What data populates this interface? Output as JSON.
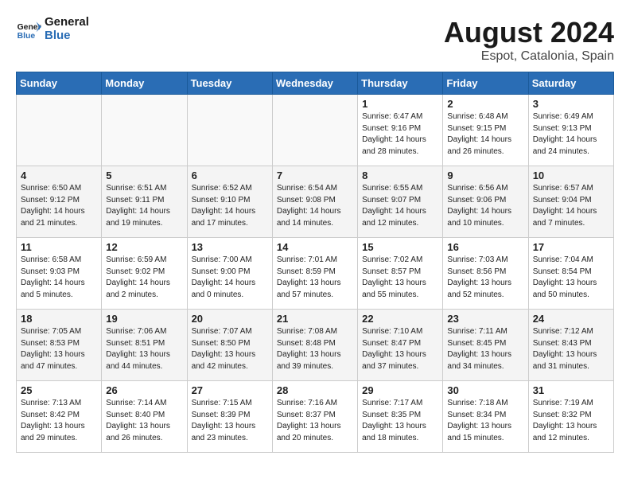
{
  "header": {
    "logo_general": "General",
    "logo_blue": "Blue",
    "month_year": "August 2024",
    "location": "Espot, Catalonia, Spain"
  },
  "days_of_week": [
    "Sunday",
    "Monday",
    "Tuesday",
    "Wednesday",
    "Thursday",
    "Friday",
    "Saturday"
  ],
  "weeks": [
    [
      {
        "day": "",
        "empty": true
      },
      {
        "day": "",
        "empty": true
      },
      {
        "day": "",
        "empty": true
      },
      {
        "day": "",
        "empty": true
      },
      {
        "day": "1",
        "sunrise": "6:47 AM",
        "sunset": "9:16 PM",
        "daylight": "14 hours and 28 minutes."
      },
      {
        "day": "2",
        "sunrise": "6:48 AM",
        "sunset": "9:15 PM",
        "daylight": "14 hours and 26 minutes."
      },
      {
        "day": "3",
        "sunrise": "6:49 AM",
        "sunset": "9:13 PM",
        "daylight": "14 hours and 24 minutes."
      }
    ],
    [
      {
        "day": "4",
        "sunrise": "6:50 AM",
        "sunset": "9:12 PM",
        "daylight": "14 hours and 21 minutes."
      },
      {
        "day": "5",
        "sunrise": "6:51 AM",
        "sunset": "9:11 PM",
        "daylight": "14 hours and 19 minutes."
      },
      {
        "day": "6",
        "sunrise": "6:52 AM",
        "sunset": "9:10 PM",
        "daylight": "14 hours and 17 minutes."
      },
      {
        "day": "7",
        "sunrise": "6:54 AM",
        "sunset": "9:08 PM",
        "daylight": "14 hours and 14 minutes."
      },
      {
        "day": "8",
        "sunrise": "6:55 AM",
        "sunset": "9:07 PM",
        "daylight": "14 hours and 12 minutes."
      },
      {
        "day": "9",
        "sunrise": "6:56 AM",
        "sunset": "9:06 PM",
        "daylight": "14 hours and 10 minutes."
      },
      {
        "day": "10",
        "sunrise": "6:57 AM",
        "sunset": "9:04 PM",
        "daylight": "14 hours and 7 minutes."
      }
    ],
    [
      {
        "day": "11",
        "sunrise": "6:58 AM",
        "sunset": "9:03 PM",
        "daylight": "14 hours and 5 minutes."
      },
      {
        "day": "12",
        "sunrise": "6:59 AM",
        "sunset": "9:02 PM",
        "daylight": "14 hours and 2 minutes."
      },
      {
        "day": "13",
        "sunrise": "7:00 AM",
        "sunset": "9:00 PM",
        "daylight": "14 hours and 0 minutes."
      },
      {
        "day": "14",
        "sunrise": "7:01 AM",
        "sunset": "8:59 PM",
        "daylight": "13 hours and 57 minutes."
      },
      {
        "day": "15",
        "sunrise": "7:02 AM",
        "sunset": "8:57 PM",
        "daylight": "13 hours and 55 minutes."
      },
      {
        "day": "16",
        "sunrise": "7:03 AM",
        "sunset": "8:56 PM",
        "daylight": "13 hours and 52 minutes."
      },
      {
        "day": "17",
        "sunrise": "7:04 AM",
        "sunset": "8:54 PM",
        "daylight": "13 hours and 50 minutes."
      }
    ],
    [
      {
        "day": "18",
        "sunrise": "7:05 AM",
        "sunset": "8:53 PM",
        "daylight": "13 hours and 47 minutes."
      },
      {
        "day": "19",
        "sunrise": "7:06 AM",
        "sunset": "8:51 PM",
        "daylight": "13 hours and 44 minutes."
      },
      {
        "day": "20",
        "sunrise": "7:07 AM",
        "sunset": "8:50 PM",
        "daylight": "13 hours and 42 minutes."
      },
      {
        "day": "21",
        "sunrise": "7:08 AM",
        "sunset": "8:48 PM",
        "daylight": "13 hours and 39 minutes."
      },
      {
        "day": "22",
        "sunrise": "7:10 AM",
        "sunset": "8:47 PM",
        "daylight": "13 hours and 37 minutes."
      },
      {
        "day": "23",
        "sunrise": "7:11 AM",
        "sunset": "8:45 PM",
        "daylight": "13 hours and 34 minutes."
      },
      {
        "day": "24",
        "sunrise": "7:12 AM",
        "sunset": "8:43 PM",
        "daylight": "13 hours and 31 minutes."
      }
    ],
    [
      {
        "day": "25",
        "sunrise": "7:13 AM",
        "sunset": "8:42 PM",
        "daylight": "13 hours and 29 minutes."
      },
      {
        "day": "26",
        "sunrise": "7:14 AM",
        "sunset": "8:40 PM",
        "daylight": "13 hours and 26 minutes."
      },
      {
        "day": "27",
        "sunrise": "7:15 AM",
        "sunset": "8:39 PM",
        "daylight": "13 hours and 23 minutes."
      },
      {
        "day": "28",
        "sunrise": "7:16 AM",
        "sunset": "8:37 PM",
        "daylight": "13 hours and 20 minutes."
      },
      {
        "day": "29",
        "sunrise": "7:17 AM",
        "sunset": "8:35 PM",
        "daylight": "13 hours and 18 minutes."
      },
      {
        "day": "30",
        "sunrise": "7:18 AM",
        "sunset": "8:34 PM",
        "daylight": "13 hours and 15 minutes."
      },
      {
        "day": "31",
        "sunrise": "7:19 AM",
        "sunset": "8:32 PM",
        "daylight": "13 hours and 12 minutes."
      }
    ]
  ],
  "labels": {
    "sunrise_prefix": "Sunrise:",
    "sunset_prefix": "Sunset:",
    "daylight_prefix": "Daylight:"
  }
}
